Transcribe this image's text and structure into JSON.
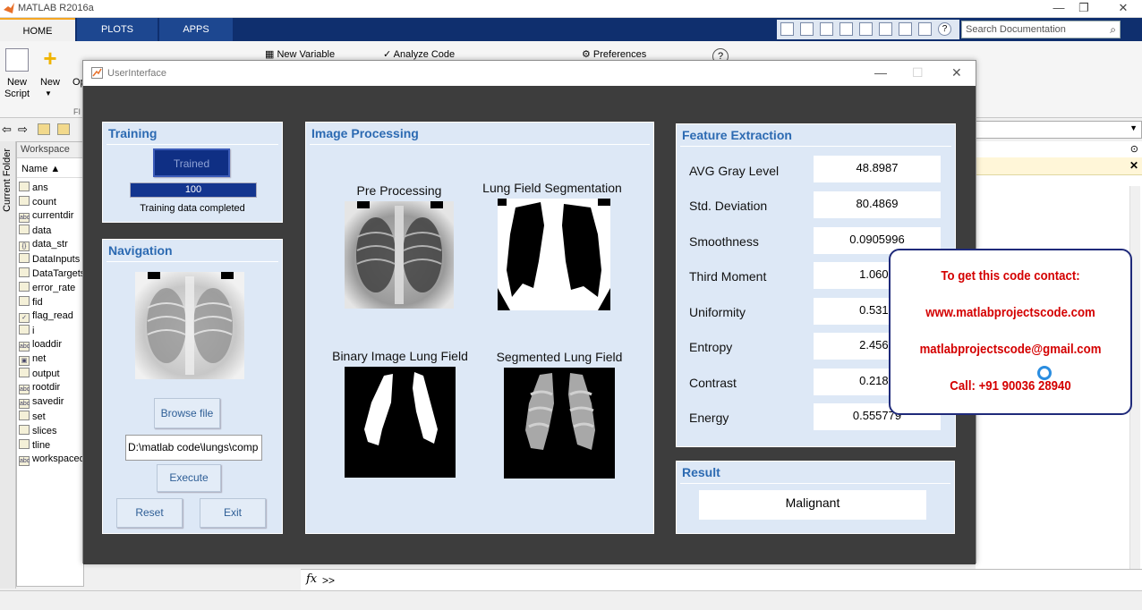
{
  "app": {
    "title": "MATLAB R2016a",
    "tabs": [
      "HOME",
      "PLOTS",
      "APPS"
    ],
    "search_placeholder": "Search Documentation",
    "ribbon": {
      "new_script": "New Script",
      "new": "New",
      "open_abbrev": "Op",
      "new_variable": "New Variable",
      "analyze_code": "Analyze Code",
      "preferences": "Preferences",
      "section_abbrev": "FI"
    },
    "current_folder_label": "Current Folder",
    "workspace": {
      "title": "Workspace",
      "name_header": "Name ▲",
      "items": [
        "ans",
        "count",
        "currentdir",
        "data",
        "data_str",
        "DataInputs",
        "DataTargets",
        "error_rate",
        "fid",
        "flag_read",
        "i",
        "loaddir",
        "net",
        "output",
        "rootdir",
        "savedir",
        "set",
        "slices",
        "tline",
        "workspaced"
      ]
    },
    "command_prompt": ">>"
  },
  "figure": {
    "title": "UserInterface",
    "training": {
      "title": "Training",
      "button_label": "Trained",
      "progress_label": "100",
      "progress_value": 100,
      "status": "Training data completed"
    },
    "navigation": {
      "title": "Navigation",
      "browse_label": "Browse file",
      "path_value": "D:\\matlab code\\lungs\\comp",
      "execute_label": "Execute",
      "reset_label": "Reset",
      "exit_label": "Exit"
    },
    "image_processing": {
      "title": "Image Processing",
      "captions": [
        "Pre Processing",
        "Lung Field Segmentation",
        "Binary Image Lung Field",
        "Segmented Lung Field"
      ]
    },
    "feature_extraction": {
      "title": "Feature Extraction",
      "features": [
        {
          "label": "AVG Gray Level",
          "value": "48.8987"
        },
        {
          "label": "Std. Deviation",
          "value": "80.4869"
        },
        {
          "label": "Smoothness",
          "value": "0.0905996"
        },
        {
          "label": "Third Moment",
          "value": "1.0609"
        },
        {
          "label": "Uniformity",
          "value": "0.5317"
        },
        {
          "label": "Entropy",
          "value": "2.4560"
        },
        {
          "label": "Contrast",
          "value": "0.2189"
        },
        {
          "label": "Energy",
          "value": "0.555779"
        }
      ]
    },
    "result": {
      "title": "Result",
      "value": "Malignant"
    }
  },
  "overlay": {
    "lines": [
      "To get this code contact:",
      "www.matlabprojectscode.com",
      "matlabprojectscode@gmail.com",
      "Call: +91 90036 28940"
    ]
  }
}
